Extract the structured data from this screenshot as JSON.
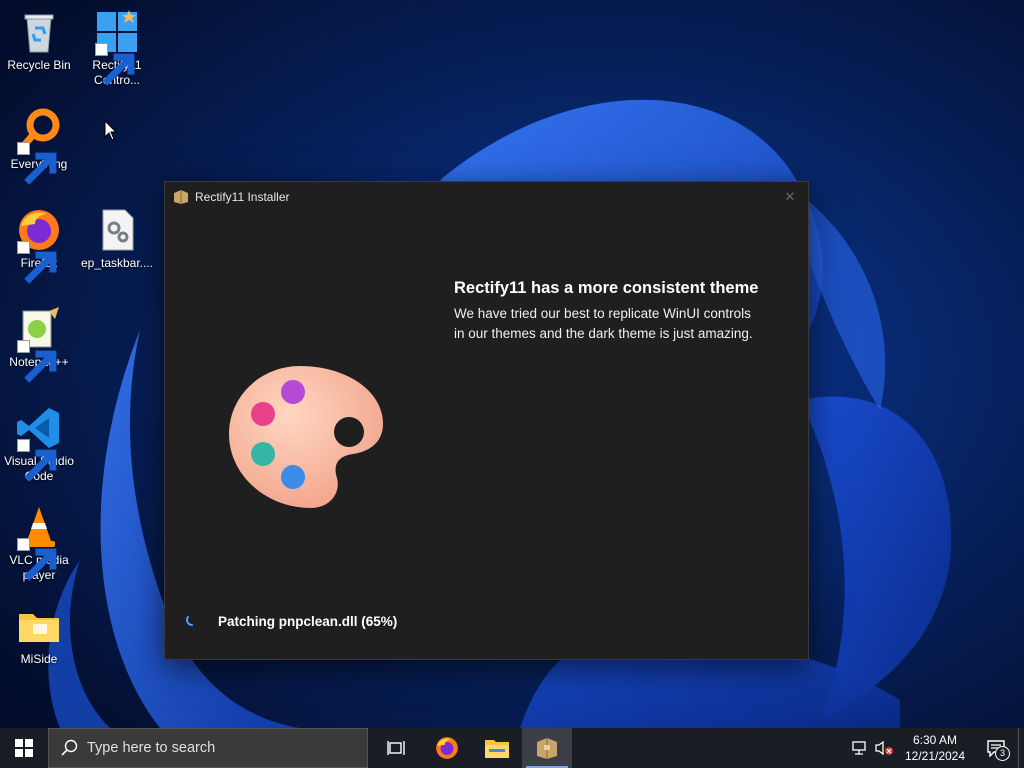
{
  "desktop": {
    "icons": [
      {
        "label": "Recycle Bin",
        "icon": "recycle-bin-icon"
      },
      {
        "label": "Rectify11 Contro...",
        "icon": "rectify11-control-panel-icon"
      },
      {
        "label": "Everything",
        "icon": "everything-search-icon"
      },
      {
        "label": "Firefox",
        "icon": "firefox-icon"
      },
      {
        "label": "ep_taskbar....",
        "icon": "settings-file-icon"
      },
      {
        "label": "Notepad++",
        "icon": "notepad-plus-plus-icon"
      },
      {
        "label": "Visual Studio Code",
        "icon": "vscode-icon"
      },
      {
        "label": "VLC media player",
        "icon": "vlc-icon"
      },
      {
        "label": "MiSide",
        "icon": "folder-icon"
      }
    ]
  },
  "installer": {
    "title": "Rectify11 Installer",
    "close_glyph": "✕",
    "headline": "Rectify11 has a more consistent theme",
    "description": "We have tried our best to replicate WinUI controls in our themes and the dark theme is just amazing.",
    "status": "Patching pnpclean.dll (65%)",
    "progress_percent": 65
  },
  "taskbar": {
    "search_placeholder": "Type here to search",
    "apps": [
      "task-view-icon",
      "firefox-icon",
      "file-explorer-icon",
      "installer-app-icon"
    ],
    "clock_time": "6:30 AM",
    "clock_date": "12/21/2024",
    "notification_count": "3"
  },
  "colors": {
    "window_bg": "#1f1f1f",
    "taskbar_bg": "#1a1d24",
    "wallpaper_bg": "#061a4a",
    "accent": "#1f6bff"
  }
}
